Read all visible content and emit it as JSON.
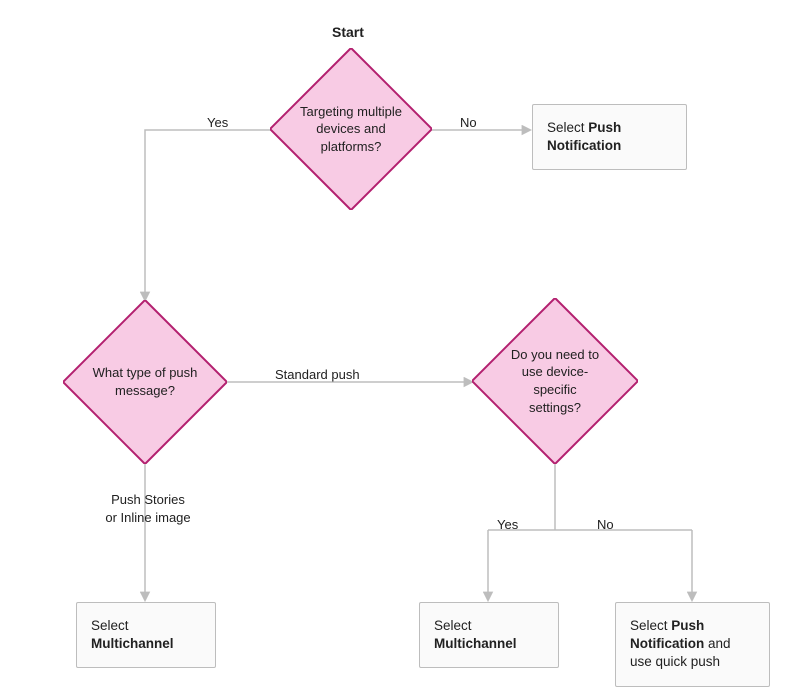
{
  "title": "Start",
  "diamonds": {
    "d1": "Targeting multiple devices and platforms?",
    "d2": "What type of push message?",
    "d3": "Do you need to use device-specific settings?"
  },
  "rects": {
    "r1_pre": "Select ",
    "r1_bold": "Push Notification",
    "r2_pre": "Select ",
    "r2_bold": "Multichannel",
    "r3_pre": "Select ",
    "r3_bold": "Multichannel",
    "r4_pre": "Select ",
    "r4_bold": "Push Notification",
    "r4_post": " and use quick push"
  },
  "labels": {
    "yes1": "Yes",
    "no1": "No",
    "standard": "Standard push",
    "push_stories": "Push Stories or Inline image",
    "yes2": "Yes",
    "no2": "No"
  },
  "colors": {
    "diamond_fill": "#f8cbe4",
    "diamond_stroke": "#b3206f",
    "rect_fill": "#fafafa",
    "rect_stroke": "#bdbdbd",
    "connector": "#bdbdbd"
  }
}
